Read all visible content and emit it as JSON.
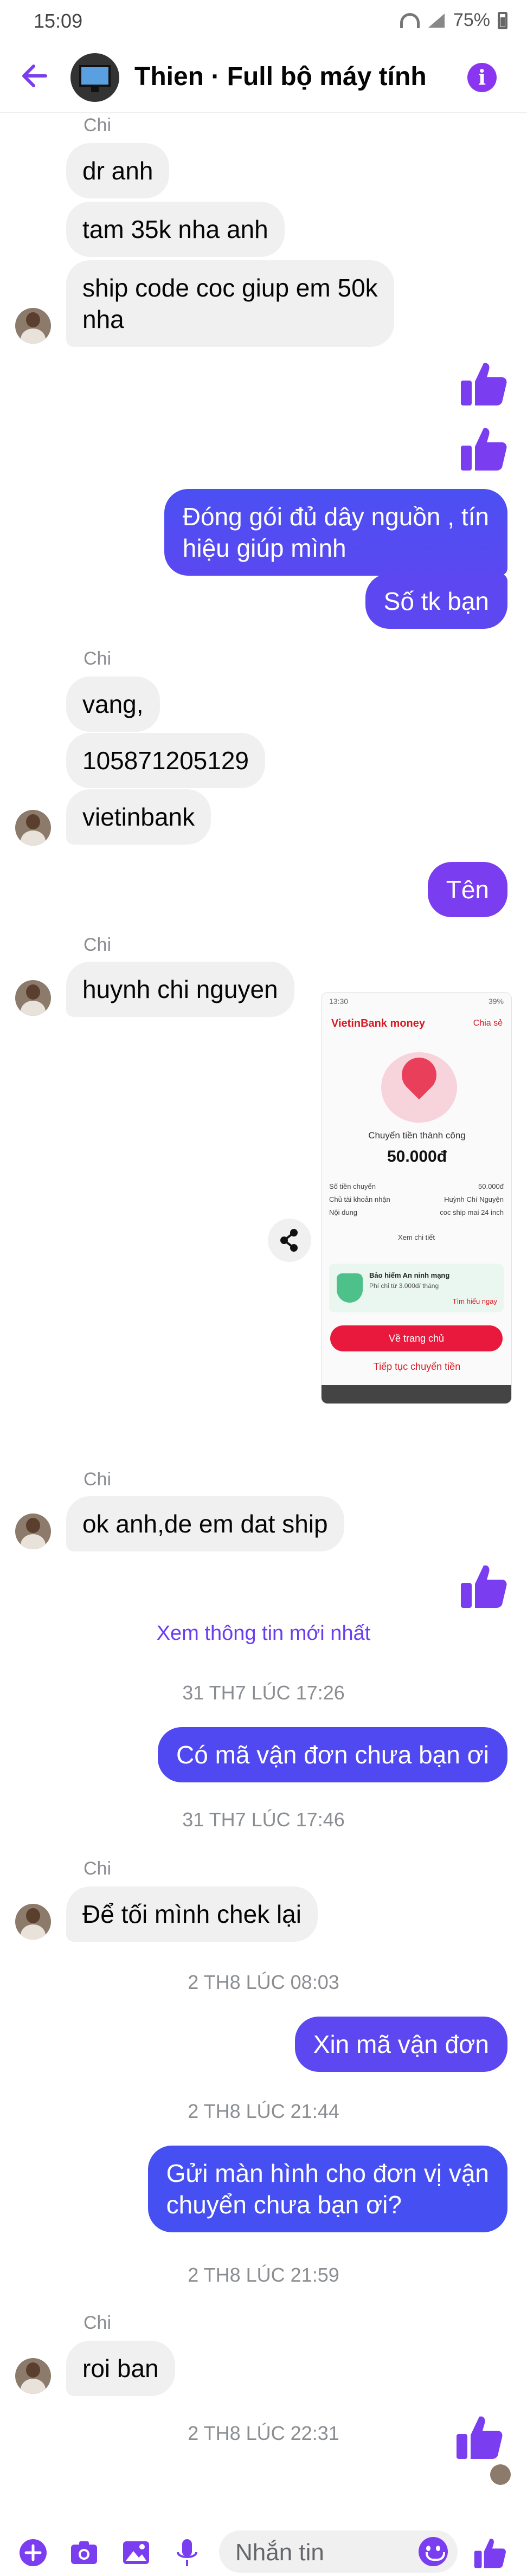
{
  "status_bar": {
    "time": "15:09",
    "battery": "75%"
  },
  "header": {
    "title": "Thien · Full bộ máy tính"
  },
  "colors": {
    "accent": "#7b3df0",
    "bubble_out_start": "#3f5bf5",
    "bubble_out_end": "#7a3df0",
    "bubble_in": "#f0f0f0"
  },
  "messages": {
    "g1_sender": "Chi",
    "m1": "dr anh",
    "m2": "tam 35k nha anh",
    "m3_l1": "ship code coc giup em 50k",
    "m3_l2": "nha",
    "o1_l1": "Đóng gói đủ dây nguồn , tín",
    "o1_l2": "hiệu giúp mình",
    "o2": "Số tk bạn",
    "g2_sender": "Chi",
    "m4": "vang,",
    "m5": "105871205129",
    "m6": "vietinbank",
    "o3": "Tên",
    "g3_sender": "Chi",
    "m7": "huynh chi nguyen",
    "g4_sender": "Chi",
    "m8": "ok anh,de em dat ship",
    "latest_link": "Xem thông tin mới nhất",
    "ts1": "31 TH7 LÚC 17:26",
    "o4": "Có mã vận đơn chưa bạn ơi",
    "ts2": "31 TH7 LÚC 17:46",
    "g5_sender": "Chi",
    "m9": "Để tối mình chek lại",
    "ts3": "2 TH8 LÚC 08:03",
    "o5": "Xin mã vận đơn",
    "ts4": "2 TH8 LÚC 21:44",
    "o6_l1": "Gửi màn hình cho đơn vị vận",
    "o6_l2": "chuyển chưa bạn ơi?",
    "ts5": "2 TH8 LÚC 21:59",
    "g6_sender": "Chi",
    "m10": "roi ban",
    "ts6": "2 TH8 LÚC 22:31"
  },
  "receipt": {
    "status_time": "13:30",
    "status_batt": "39%",
    "logo": "VietinBank money",
    "share": "Chia sẻ",
    "success": "Chuyển tiền thành công",
    "amount": "50.000đ",
    "rows": [
      {
        "label": "Số tiền chuyển",
        "value": "50.000đ"
      },
      {
        "label": "Chủ tài khoản nhận",
        "value": "Huỳnh Chí Nguyện"
      },
      {
        "label": "Nội dung",
        "value": "coc ship mai 24 inch"
      }
    ],
    "detail_link": "Xem chi tiết",
    "insurance_title": "Bảo hiểm An ninh mạng",
    "insurance_desc": "Phí chỉ từ 3.000đ/ tháng",
    "insurance_link": "Tìm hiểu ngay",
    "home_button": "Về trang chủ",
    "continue": "Tiếp tục chuyển tiền"
  },
  "composer": {
    "placeholder": "Nhắn tin"
  }
}
